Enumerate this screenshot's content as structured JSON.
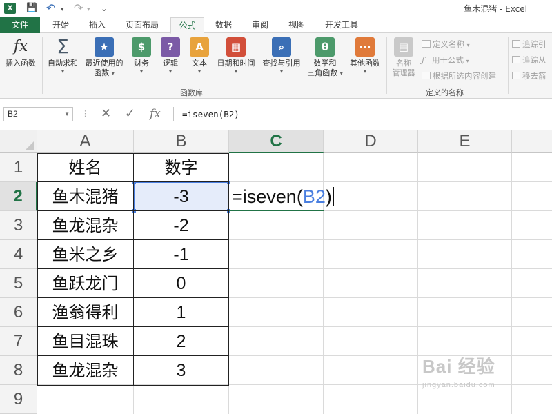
{
  "window": {
    "title": "鱼木混猪 - Excel"
  },
  "quick_access": {
    "app_logo": "X",
    "save": "💾",
    "undo": "↶",
    "redo": "↷",
    "customize": "⌄"
  },
  "ribbon_tabs": [
    "文件",
    "开始",
    "插入",
    "页面布局",
    "公式",
    "数据",
    "审阅",
    "视图",
    "开发工具"
  ],
  "active_tab": "公式",
  "function_library": {
    "group_label": "函数库",
    "insert_function": {
      "label": "插入函数",
      "icon": "fx"
    },
    "buttons": [
      {
        "label": "自动求和",
        "icon": "Σ",
        "color": "#5a6b7d"
      },
      {
        "label": "最近使用的",
        "label2": "函数",
        "icon": "★",
        "color": "#3b6fb6"
      },
      {
        "label": "财务",
        "icon": "$",
        "color": "#4d9a6b"
      },
      {
        "label": "逻辑",
        "icon": "?",
        "color": "#7b5aa6"
      },
      {
        "label": "文本",
        "icon": "A",
        "color": "#e8a33d"
      },
      {
        "label": "日期和时间",
        "icon": "▦",
        "color": "#d24f3a"
      },
      {
        "label": "查找与引用",
        "icon": "⌕",
        "color": "#3b6fb6"
      },
      {
        "label": "数学和",
        "label2": "三角函数",
        "icon": "θ",
        "color": "#4d9a6b"
      },
      {
        "label": "其他函数",
        "icon": "···",
        "color": "#e07a3a"
      }
    ]
  },
  "defined_names": {
    "group_label": "定义的名称",
    "name_manager": {
      "label": "名称",
      "label2": "管理器"
    },
    "define_name": "定义名称",
    "use_in_formula": "用于公式",
    "create_from_selection": "根据所选内容创建"
  },
  "formula_auditing": {
    "trace_precedents": "追踪引",
    "trace_dependents": "追踪从",
    "remove_arrows": "移去箭"
  },
  "formula_bar": {
    "name_box": "B2",
    "cancel": "✕",
    "enter": "✓",
    "fx": "fx",
    "content": "=iseven(B2)"
  },
  "columns": [
    "A",
    "B",
    "C",
    "D",
    "E"
  ],
  "selected_column": "C",
  "rows": [
    "1",
    "2",
    "3",
    "4",
    "5",
    "6",
    "7",
    "8",
    "9"
  ],
  "selected_row": "2",
  "table": {
    "headers": [
      "姓名",
      "数字"
    ],
    "data": [
      [
        "鱼木混猪",
        "-3"
      ],
      [
        "鱼龙混杂",
        "-2"
      ],
      [
        "鱼米之乡",
        "-1"
      ],
      [
        "鱼跃龙门",
        "0"
      ],
      [
        "渔翁得利",
        "1"
      ],
      [
        "鱼目混珠",
        "2"
      ],
      [
        "鱼龙混杂",
        "3"
      ]
    ]
  },
  "editing_cell": {
    "address": "C2",
    "prefix": "=iseven(",
    "ref": "B2",
    "suffix": ")"
  },
  "watermark": {
    "main": "Bai 经验",
    "url": "jingyan.baidu.com"
  },
  "colors": {
    "excel_green": "#217346",
    "ref_blue": "#4a7fe0"
  }
}
